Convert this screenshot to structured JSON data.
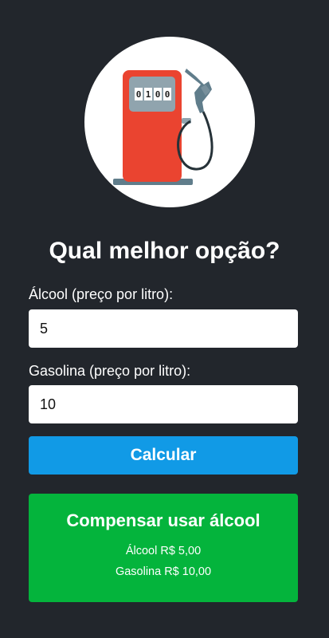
{
  "logo": {
    "icon": "fuel-pump-icon",
    "counter_digits": [
      "0",
      "1",
      "0",
      "0"
    ]
  },
  "title": "Qual melhor opção?",
  "form": {
    "alcool_label": "Álcool (preço por litro):",
    "alcool_value": "5",
    "gasolina_label": "Gasolina (preço por litro):",
    "gasolina_value": "10",
    "calculate_label": "Calcular"
  },
  "result": {
    "title": "Compensar usar álcool",
    "alcool_line": "Álcool R$ 5,00",
    "gasolina_line": "Gasolina R$ 10,00"
  },
  "colors": {
    "background": "#22262c",
    "button": "#119ae6",
    "result": "#04b43c",
    "pump_red": "#ea4430",
    "pump_gray": "#607d8b"
  }
}
